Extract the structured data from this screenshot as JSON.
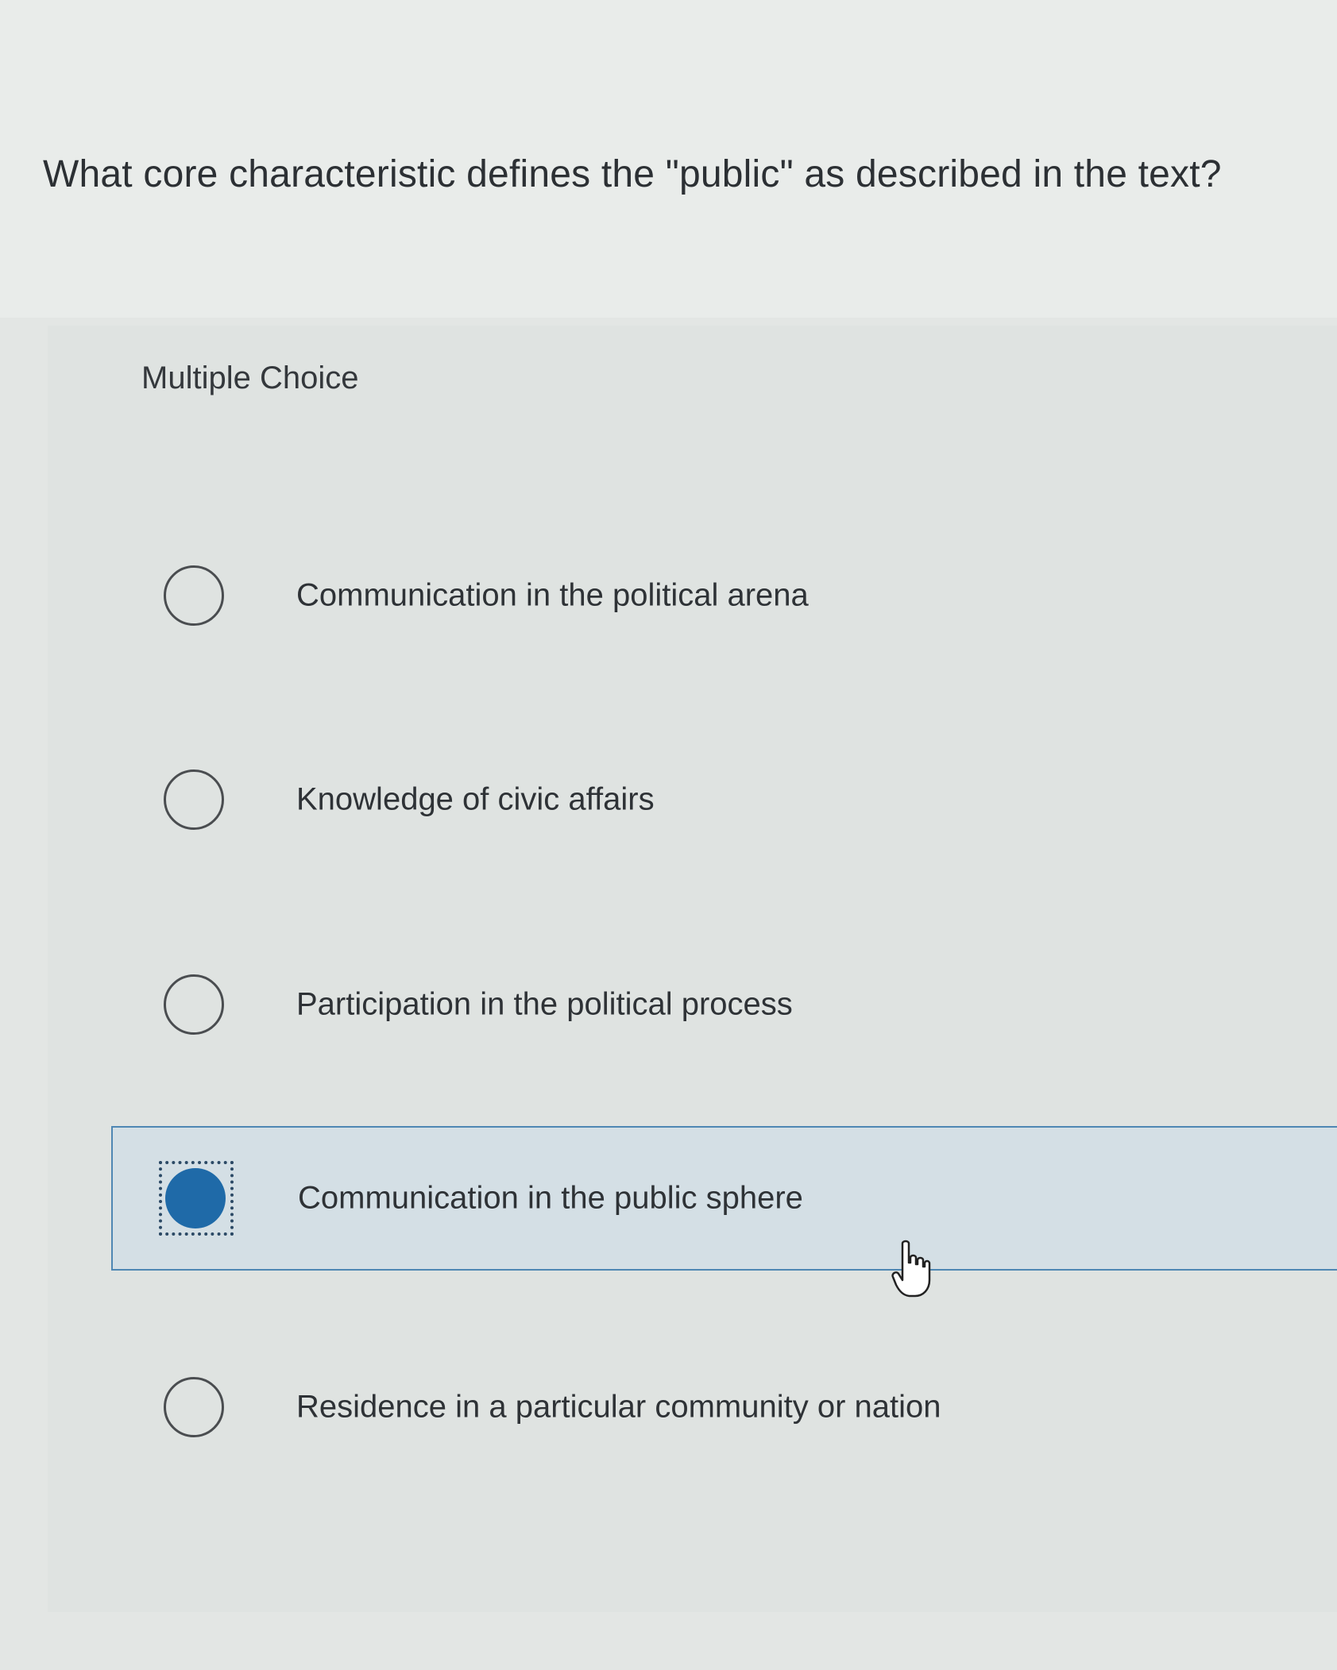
{
  "question": {
    "text": "What core characteristic defines the \"public\" as described in the text?"
  },
  "answer_section": {
    "type_label": "Multiple Choice",
    "options": [
      {
        "label": "Communication in the political arena",
        "selected": false
      },
      {
        "label": "Knowledge of civic affairs",
        "selected": false
      },
      {
        "label": "Participation in the political process",
        "selected": false
      },
      {
        "label": "Communication in the public sphere",
        "selected": true
      },
      {
        "label": "Residence in a particular community or nation",
        "selected": false
      }
    ]
  },
  "colors": {
    "selected_fill": "#1f6aa8",
    "selected_row_background": "#d4dfe5",
    "selected_row_border": "#4f87b3"
  },
  "icons": {
    "unselected_radio": "empty-circle",
    "selected_radio": "filled-circle",
    "cursor": "hand-pointer-icon"
  }
}
